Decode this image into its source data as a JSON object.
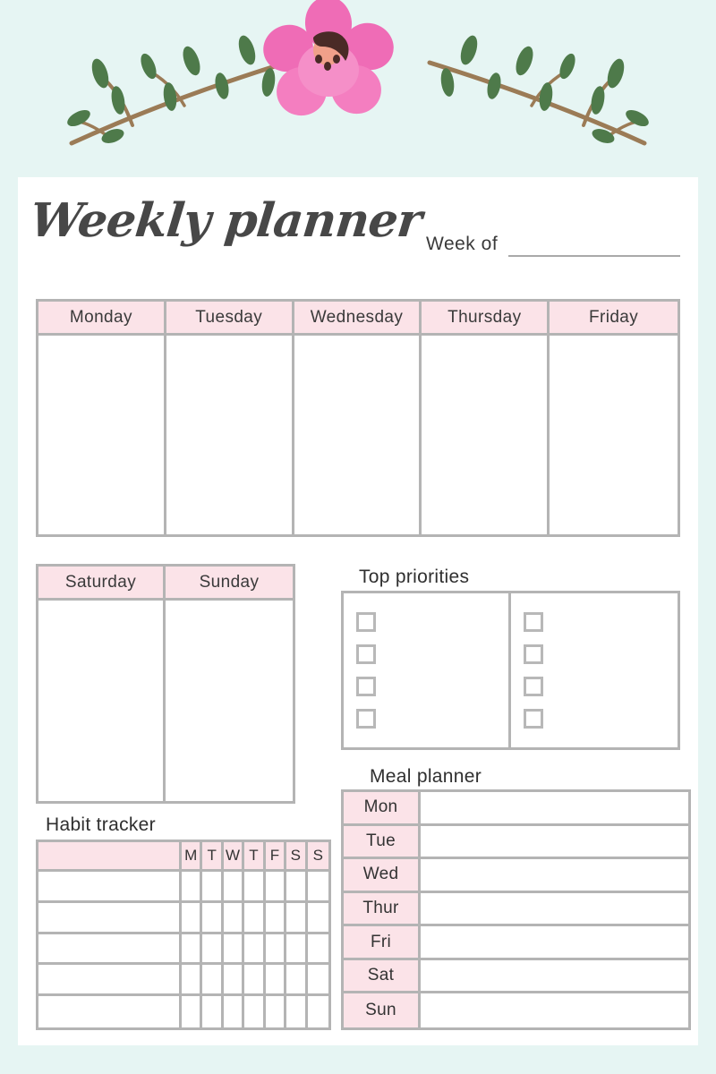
{
  "page": {
    "background_color": "#e6f5f3",
    "paper_color": "#ffffff",
    "accent_pink": "#fbe3e8",
    "border_gray": "#b4b4b4",
    "text_color": "#3a3a3a"
  },
  "header": {
    "decoration": "watercolor-floral-branch-with-pink-flower",
    "flower_color": "#ec5fb0",
    "leaf_color": "#4e7a4a",
    "branch_color": "#9b7b56"
  },
  "title": {
    "text": "Weekly planner",
    "week_of_label": "Week of",
    "week_of_value": ""
  },
  "weekday_grid": {
    "headers": [
      "Monday",
      "Tuesday",
      "Wednesday",
      "Thursday",
      "Friday"
    ],
    "cells": [
      "",
      "",
      "",
      "",
      ""
    ]
  },
  "weekend_grid": {
    "headers": [
      "Saturday",
      "Sunday"
    ],
    "cells": [
      "",
      ""
    ]
  },
  "top_priorities": {
    "label": "Top priorities",
    "left_column": [
      "",
      "",
      "",
      ""
    ],
    "right_column": [
      "",
      "",
      "",
      ""
    ]
  },
  "habit_tracker": {
    "label": "Habit tracker",
    "name_header": "",
    "day_headers": [
      "M",
      "T",
      "W",
      "T",
      "F",
      "S",
      "S"
    ],
    "rows": [
      {
        "name": "",
        "days": [
          "",
          "",
          "",
          "",
          "",
          "",
          ""
        ]
      },
      {
        "name": "",
        "days": [
          "",
          "",
          "",
          "",
          "",
          "",
          ""
        ]
      },
      {
        "name": "",
        "days": [
          "",
          "",
          "",
          "",
          "",
          "",
          ""
        ]
      },
      {
        "name": "",
        "days": [
          "",
          "",
          "",
          "",
          "",
          "",
          ""
        ]
      },
      {
        "name": "",
        "days": [
          "",
          "",
          "",
          "",
          "",
          "",
          ""
        ]
      }
    ]
  },
  "meal_planner": {
    "label": "Meal planner",
    "rows": [
      {
        "day": "Mon",
        "meal": ""
      },
      {
        "day": "Tue",
        "meal": ""
      },
      {
        "day": "Wed",
        "meal": ""
      },
      {
        "day": "Thur",
        "meal": ""
      },
      {
        "day": "Fri",
        "meal": ""
      },
      {
        "day": "Sat",
        "meal": ""
      },
      {
        "day": "Sun",
        "meal": ""
      }
    ]
  }
}
